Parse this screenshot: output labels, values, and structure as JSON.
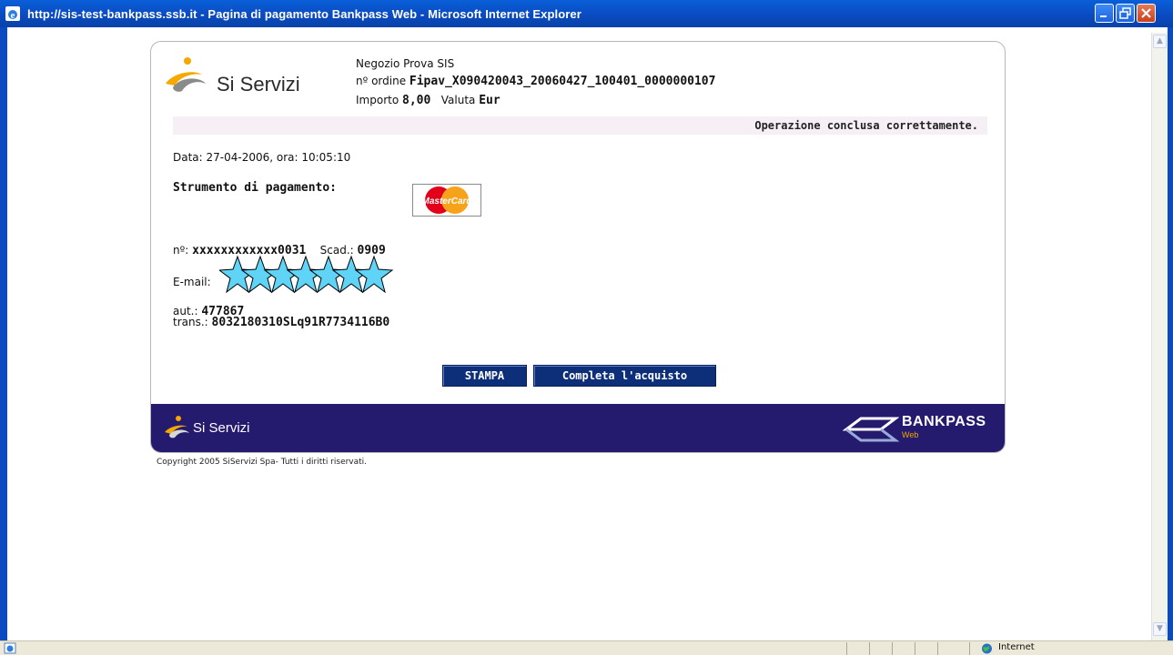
{
  "window": {
    "title": "http://sis-test-bankpass.ssb.it - Pagina di pagamento Bankpass Web - Microsoft Internet Explorer"
  },
  "header": {
    "logo_text": "Si Servizi",
    "merchant_name": "Negozio Prova SIS",
    "order_label": "nº ordine",
    "order_value": "Fipav_X090420043_20060427_100401_0000000107",
    "amount_label": "Importo",
    "amount_value": "8,00",
    "currency_label": "Valuta",
    "currency_value": "Eur"
  },
  "status_message": "Operazione conclusa correttamente.",
  "details": {
    "date_line": "Data: 27-04-2006, ora: 10:05:10",
    "payment_method_label": "Strumento di pagamento:",
    "card_brand": "MasterCard",
    "card_number_label": "nº:",
    "card_number_value": "xxxxxxxxxxxx0031",
    "expiry_label": "Scad.:",
    "expiry_value": "0909",
    "email_label": "E-mail:",
    "auth_label": "aut.:",
    "auth_value": "477867",
    "trans_label": "trans.:",
    "trans_value": "8032180310SLq91R7734116B0"
  },
  "buttons": {
    "print_label": "STAMPA",
    "complete_label": "Completa l'acquisto"
  },
  "footer": {
    "logo_text": "Si Servizi",
    "bankpass_text": "BANKPASS",
    "bankpass_sub": "Web",
    "copyright": "Copyright 2005 SiServizi Spa- Tutti i diritti riservati."
  },
  "ie_status": {
    "zone_label": "Internet"
  },
  "colors": {
    "titlebar": "#0a4bc2",
    "button_bg": "#0d2f7a",
    "footer_band": "#241a6e",
    "status_strip": "#f6f0f6",
    "logo_orange": "#f5a800"
  }
}
